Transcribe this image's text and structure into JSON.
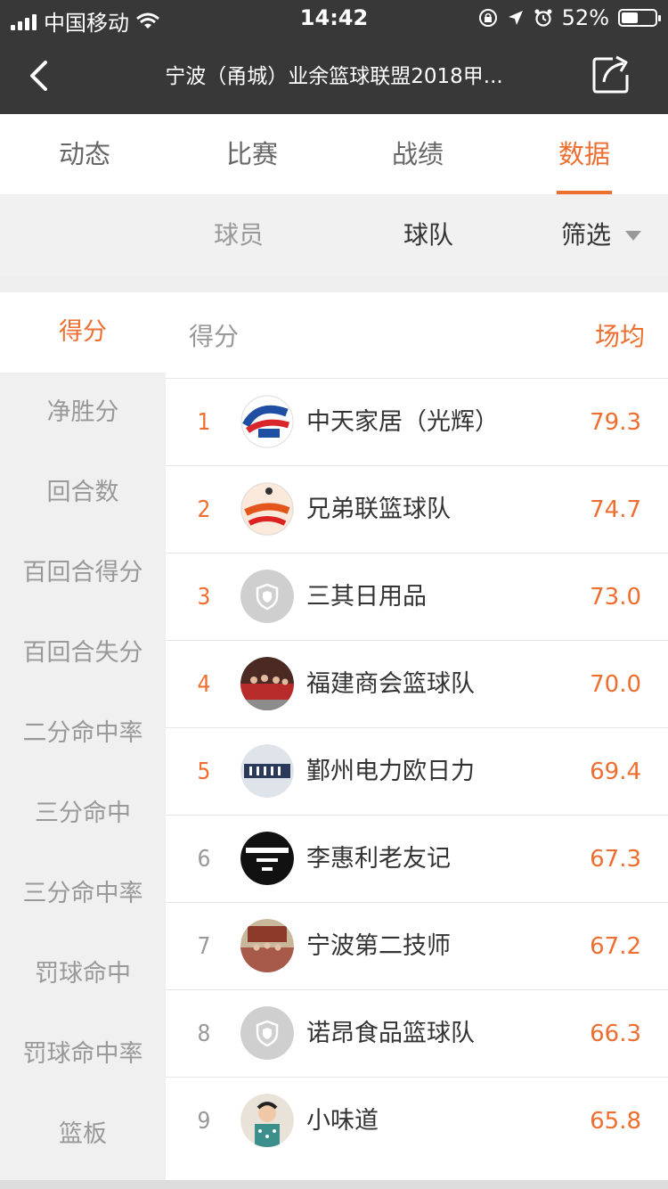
{
  "status": {
    "carrier": "中国移动",
    "time": "14:42",
    "battery": "52%"
  },
  "nav": {
    "title": "宁波（甬城）业余篮球联盟2018甲..."
  },
  "tabs": [
    {
      "label": "动态"
    },
    {
      "label": "比赛"
    },
    {
      "label": "战绩"
    },
    {
      "label": "数据"
    }
  ],
  "active_tab": "数据",
  "subtabs": {
    "player": "球员",
    "team": "球队",
    "filter": "筛选"
  },
  "categories": [
    "得分",
    "净胜分",
    "回合数",
    "百回合得分",
    "百回合失分",
    "二分命中率",
    "三分命中",
    "三分命中率",
    "罚球命中",
    "罚球命中率",
    "篮板"
  ],
  "list": {
    "title": "得分",
    "avg_label": "场均",
    "rows": [
      {
        "rank": "1",
        "name": "中天家居（光辉）",
        "value": "79.3"
      },
      {
        "rank": "2",
        "name": "兄弟联篮球队",
        "value": "74.7"
      },
      {
        "rank": "3",
        "name": "三其日用品",
        "value": "73.0"
      },
      {
        "rank": "4",
        "name": "福建商会篮球队",
        "value": "70.0"
      },
      {
        "rank": "5",
        "name": "鄞州电力欧日力",
        "value": "69.4"
      },
      {
        "rank": "6",
        "name": "李惠利老友记",
        "value": "67.3"
      },
      {
        "rank": "7",
        "name": "宁波第二技师",
        "value": "67.2"
      },
      {
        "rank": "8",
        "name": "诺昂食品篮球队",
        "value": "66.3"
      },
      {
        "rank": "9",
        "name": "小味道",
        "value": "65.8"
      }
    ]
  },
  "colors": {
    "accent": "#ee6e30",
    "nav_bg": "#383838"
  }
}
